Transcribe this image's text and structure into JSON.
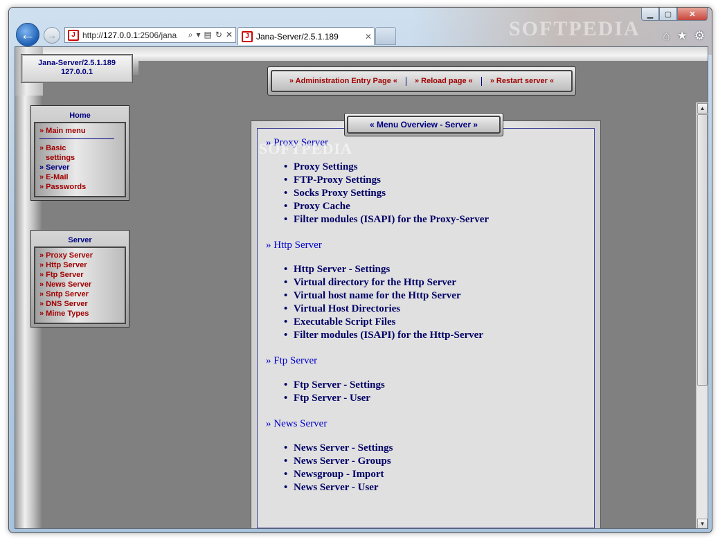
{
  "browser": {
    "address_prefix": "http://",
    "address_host": "127.0.0.1",
    "address_rest": ":2506/jana",
    "tab_title": "Jana-Server/2.5.1.189",
    "watermark": "SOFTPEDIA"
  },
  "header": {
    "brand_line1": "Jana-Server/2.5.1.189",
    "brand_line2": "127.0.0.1"
  },
  "topnav": {
    "items": [
      "» Administration Entry Page «",
      "» Reload page «",
      "» Restart server «"
    ]
  },
  "home_panel": {
    "title": "Home",
    "main_menu": "» Main menu",
    "items": [
      {
        "label": "» Basic",
        "label2": "settings"
      },
      {
        "label": "» Server"
      },
      {
        "label": "» E-Mail"
      },
      {
        "label": "» Passwords"
      }
    ]
  },
  "server_panel": {
    "title": "Server",
    "items": [
      "» Proxy Server",
      "» Http Server",
      "» Ftp Server",
      "» News Server",
      "» Sntp Server",
      "» DNS Server",
      "» Mime Types"
    ]
  },
  "main": {
    "title": "« Menu Overview - Server »",
    "watermark": "SOFTPEDIA",
    "sections": [
      {
        "heading": "» Proxy Server",
        "items": [
          "Proxy Settings",
          "FTP-Proxy Settings",
          "Socks Proxy Settings",
          "Proxy Cache",
          "Filter modules (ISAPI) for the Proxy-Server"
        ]
      },
      {
        "heading": "» Http Server",
        "items": [
          "Http Server - Settings",
          "Virtual directory for the Http Server",
          "Virtual host name for the Http Server",
          "Virtual Host Directories",
          "Executable Script Files",
          "Filter modules (ISAPI) for the Http-Server"
        ]
      },
      {
        "heading": "» Ftp Server",
        "items": [
          "Ftp Server - Settings",
          "Ftp Server - User"
        ]
      },
      {
        "heading": "» News Server",
        "items": [
          "News Server - Settings",
          "News Server - Groups",
          "Newsgroup - Import",
          "News Server - User"
        ]
      }
    ]
  }
}
